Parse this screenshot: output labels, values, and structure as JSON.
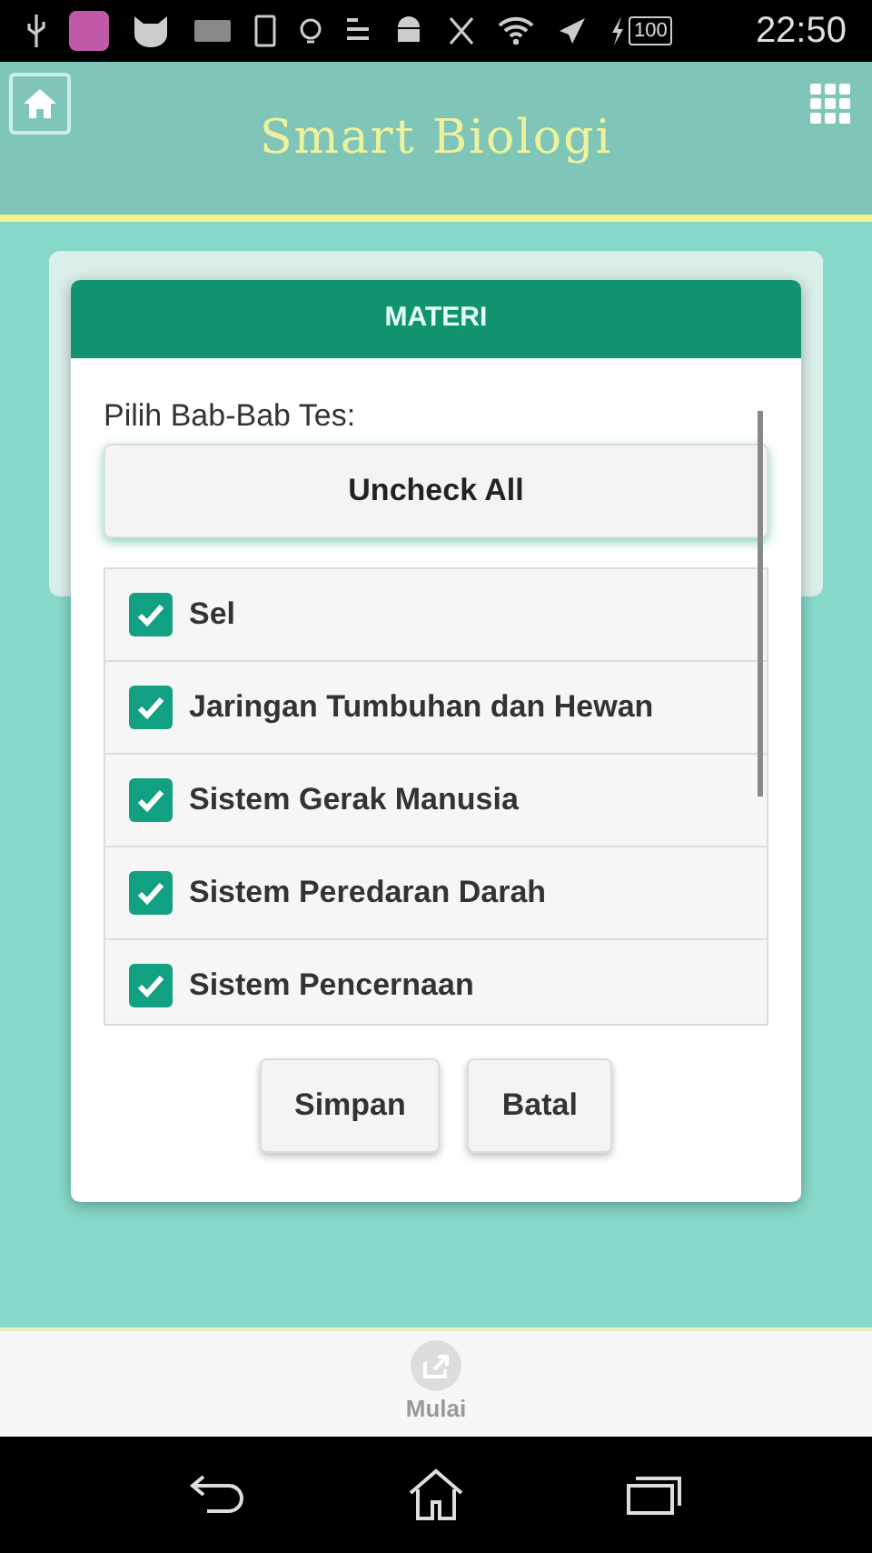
{
  "status_bar": {
    "battery": "100",
    "time": "22:50"
  },
  "header": {
    "title": "Smart Biologi"
  },
  "dialog": {
    "title": "MATERI",
    "prompt": "Pilih Bab-Bab Tes:",
    "uncheck_button": "Uncheck All",
    "items": [
      {
        "label": "Sel",
        "checked": true
      },
      {
        "label": "Jaringan Tumbuhan dan Hewan",
        "checked": true
      },
      {
        "label": "Sistem Gerak Manusia",
        "checked": true
      },
      {
        "label": "Sistem Peredaran Darah",
        "checked": true
      },
      {
        "label": "Sistem Pencernaan",
        "checked": true
      }
    ],
    "buttons": [
      "Simpan",
      "Batal"
    ]
  },
  "bottom_bar": {
    "label": "Mulai"
  }
}
